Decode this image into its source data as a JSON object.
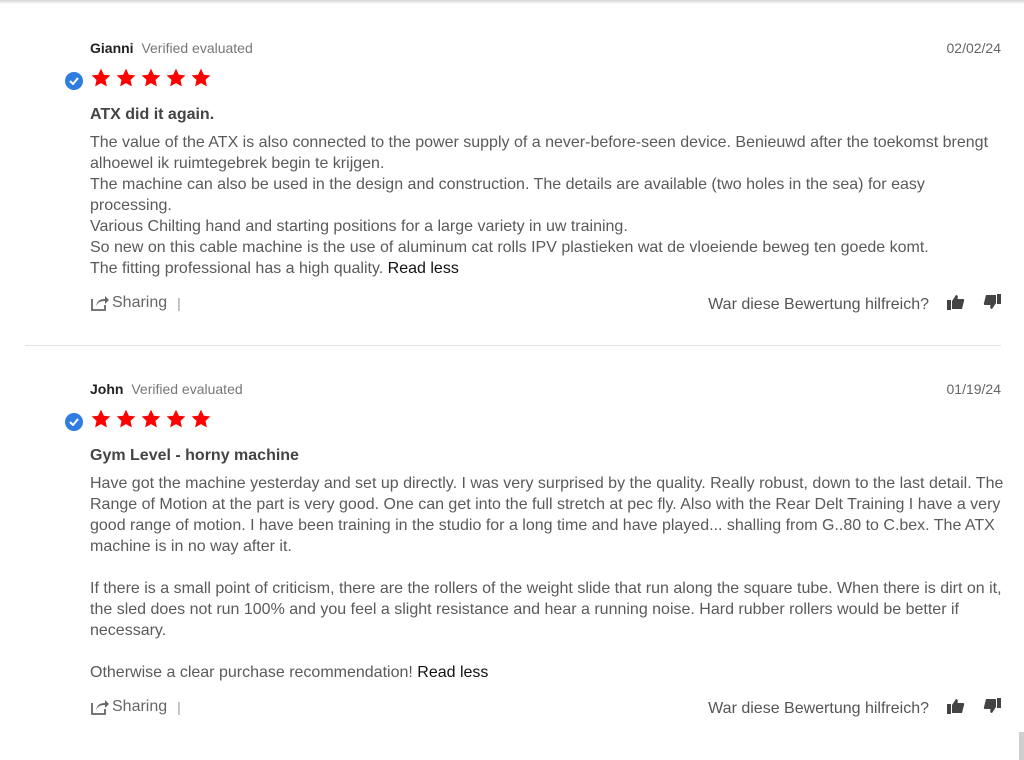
{
  "reviews": [
    {
      "author": "Gianni",
      "verified": "Verified evaluated",
      "date": "02/02/24",
      "rating": 5,
      "title": "ATX did it again.",
      "paragraphs": [
        "The value of the ATX is also connected to the power supply of a never-before-seen device. Benieuwd after the toekomst brengt alhoewel ik ruimtegebrek begin te krijgen.",
        "The machine can also be used in the design and construction. The details are available (two holes in the sea) for easy processing.",
        "Various Chilting hand and starting positions for a large variety in uw training.",
        "So new on this cable machine is the use of aluminum cat rolls IPV plastieken wat de vloeiende beweg ten goede komt.",
        "The fitting professional has a high quality."
      ],
      "read_less": "Read less",
      "share_label": "Sharing",
      "separator": "|",
      "helpful_question": "War diese Bewertung hilfreich?"
    },
    {
      "author": "John",
      "verified": "Verified evaluated",
      "date": "01/19/24",
      "rating": 5,
      "title": "Gym Level - horny machine",
      "paragraphs": [
        "Have got the machine yesterday and set up directly. I was very surprised by the quality. Really robust, down to the last detail. The Range of Motion at the part is very good. One can get into the full stretch at pec fly. Also with the Rear Delt Training I have a very good range of motion. I have been training in the studio for a long time and have played... shalling from G..80 to C.bex. The ATX machine is in no way after it.",
        "If there is a small point of criticism, there are the rollers of the weight slide that run along the square tube. When there is dirt on it, the sled does not run 100% and you feel a slight resistance and hear a running noise. Hard rubber rollers would be better if necessary.",
        "Otherwise a clear purchase recommendation!"
      ],
      "read_less": "Read less",
      "share_label": "Sharing",
      "separator": "|",
      "helpful_question": "War diese Bewertung hilfreich?"
    }
  ],
  "colors": {
    "star": "#ff0000",
    "verified_badge": "#2f7de1"
  },
  "icons": {
    "verified": "check-circle-icon",
    "star": "star-icon",
    "share": "share-icon",
    "thumbs_up": "thumbs-up-icon",
    "thumbs_down": "thumbs-down-icon"
  }
}
